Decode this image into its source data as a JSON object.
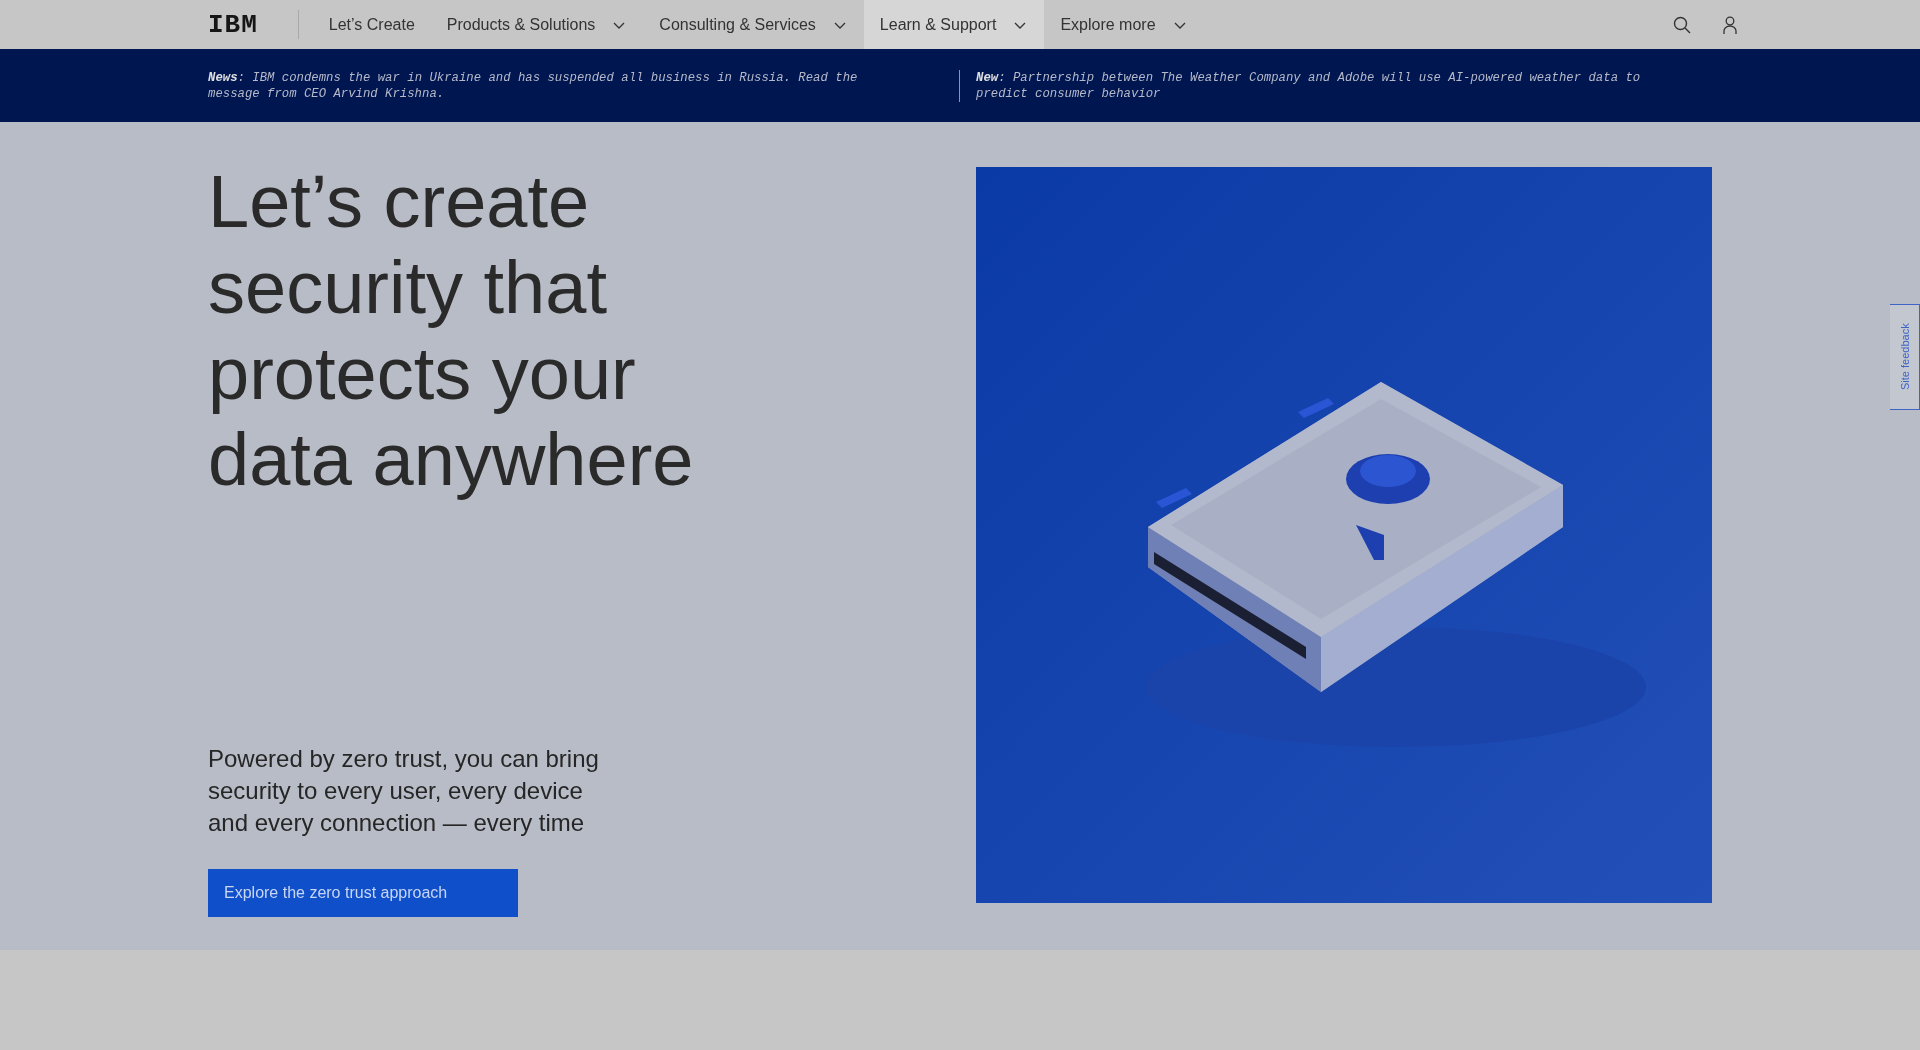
{
  "logo": "IBM",
  "nav": [
    {
      "label": "Let’s Create",
      "has_menu": false,
      "selected": false
    },
    {
      "label": "Products & Solutions",
      "has_menu": true,
      "selected": false
    },
    {
      "label": "Consulting & Services",
      "has_menu": true,
      "selected": false
    },
    {
      "label": "Learn & Support",
      "has_menu": true,
      "selected": true
    },
    {
      "label": "Explore more",
      "has_menu": true,
      "selected": false
    }
  ],
  "news": [
    {
      "text": "**News**: IBM condemns the war in Ukraine and has suspended all business in Russia. Read the message from CEO Arvind Krishna."
    },
    {
      "text": "**New**: Partnership between The Weather Company and Adobe will use AI-powered weather data to predict consumer behavior"
    }
  ],
  "hero": {
    "title": "Let’s create security that protects your data anywhere",
    "subtitle": "Powered by zero trust, you can bring security to every user, every device and every connection — every time",
    "button": "Explore the zero trust approach"
  },
  "feedback_tab": "Site feedback"
}
